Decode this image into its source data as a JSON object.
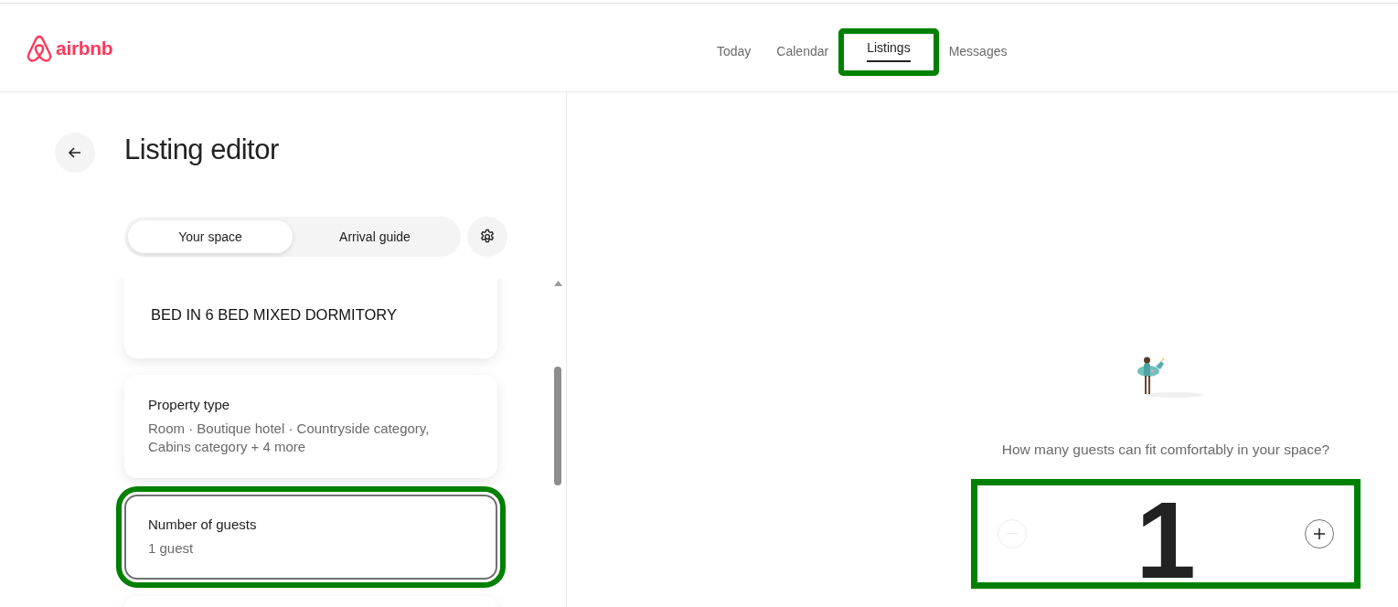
{
  "header": {
    "logo_text": "airbnb",
    "nav": [
      {
        "label": "Today",
        "selected": false,
        "highlighted": false
      },
      {
        "label": "Calendar",
        "selected": false,
        "highlighted": false
      },
      {
        "label": "Listings",
        "selected": true,
        "highlighted": true
      },
      {
        "label": "Messages",
        "selected": false,
        "highlighted": false
      }
    ]
  },
  "editor": {
    "title": "Listing editor",
    "tabs": [
      {
        "label": "Your space",
        "selected": true
      },
      {
        "label": "Arrival guide",
        "selected": false
      }
    ],
    "cards": [
      {
        "kind": "plain",
        "text": "BED IN 6 BED MIXED DORMITORY",
        "highlighted": false
      },
      {
        "kind": "setting",
        "title": "Property type",
        "value": "Room · Boutique hotel · Countryside category, Cabins category + 4 more",
        "highlighted": false
      },
      {
        "kind": "setting",
        "title": "Number of guests",
        "value": "1 guest",
        "highlighted": true
      }
    ]
  },
  "guests": {
    "question": "How many guests can fit comfortably in your space?",
    "value": "1",
    "highlighted": true,
    "decrease": {
      "disabled": true
    },
    "increase": {
      "disabled": false
    }
  }
}
